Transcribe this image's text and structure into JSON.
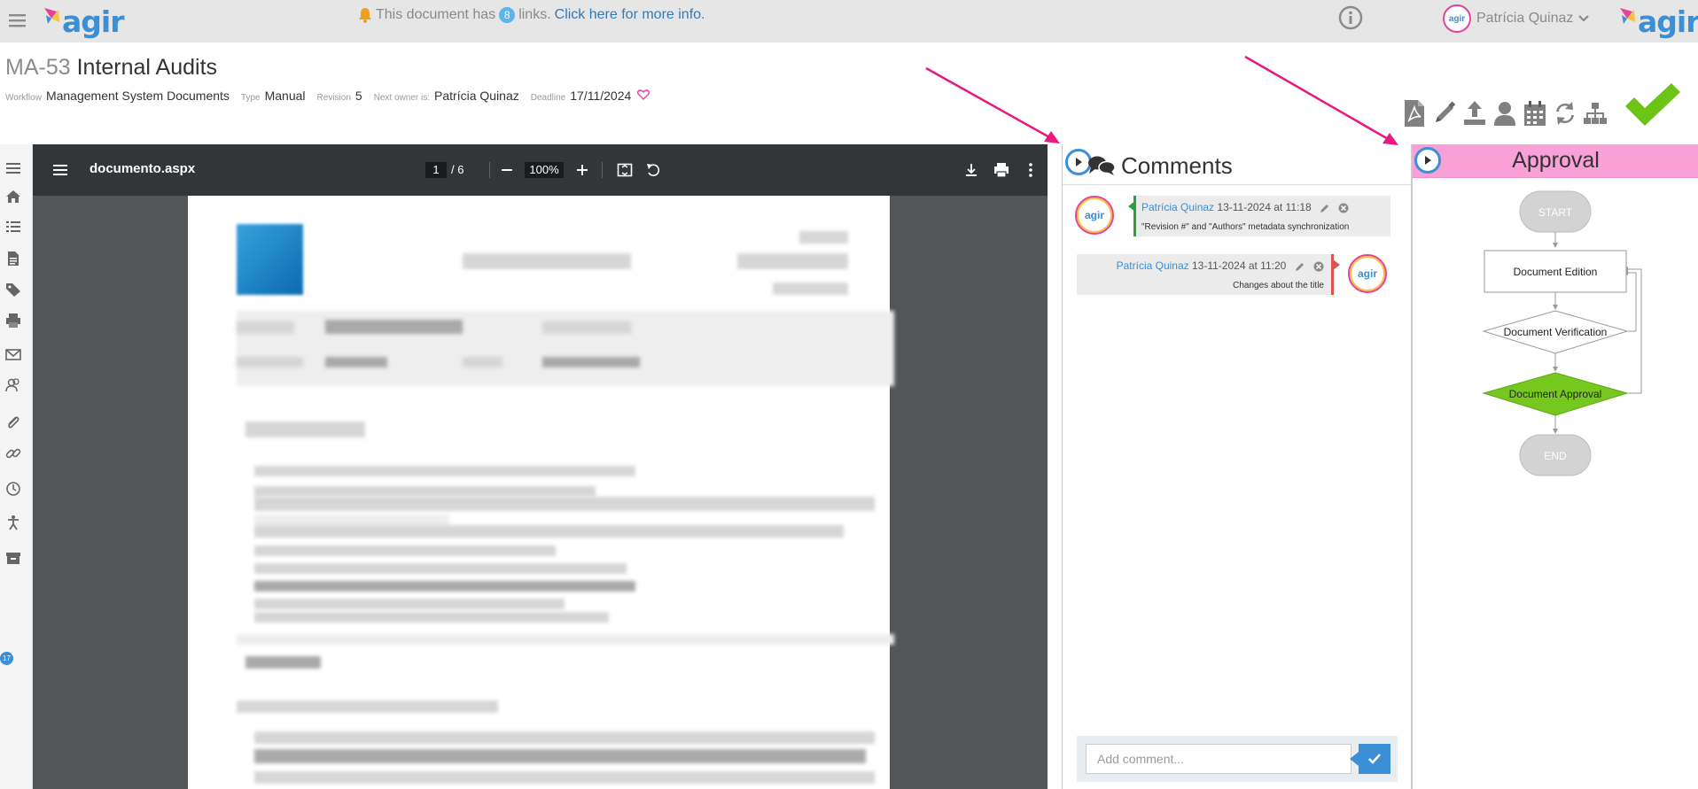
{
  "topbar": {
    "logo_text": "agir",
    "notice_prefix": "This document has",
    "notice_count": "8",
    "notice_suffix": "links.",
    "notice_link": "Click here for more info.",
    "user_name": "Patrícia Quinaz",
    "avatar_text": "agir"
  },
  "header": {
    "code": "MA-53",
    "title": "Internal Audits",
    "meta": {
      "workflow_label": "Workflow",
      "workflow_value": "Management System Documents",
      "type_label": "Type",
      "type_value": "Manual",
      "revision_label": "Revision",
      "revision_value": "5",
      "next_owner_label": "Next owner is:",
      "next_owner_value": "Patrícia Quinaz",
      "deadline_label": "Deadline",
      "deadline_value": "17/11/2024"
    },
    "actions": [
      "pdf-icon",
      "edit-icon",
      "upload-icon",
      "user-icon",
      "calendar-icon",
      "refresh-icon",
      "sitemap-icon",
      "check-icon"
    ]
  },
  "leftnav": {
    "icons": [
      "menu-icon",
      "home-icon",
      "list-icon",
      "document-icon",
      "tag-icon",
      "print-icon",
      "mail-icon",
      "users-icon",
      "paperclip-icon",
      "link-icon",
      "clock-icon",
      "accessibility-icon",
      "archive-icon"
    ],
    "badge": "17"
  },
  "pdf": {
    "filename": "documento.aspx",
    "page": "1",
    "page_total": "/ 6",
    "zoom": "100%"
  },
  "comments": {
    "title": "Comments",
    "items": [
      {
        "author": "Patrícia Quinaz",
        "date": "13-11-2024 at 11:18",
        "text": "\"Revision #\" and \"Authors\" metadata synchronization",
        "accent": "#2e9e3e"
      },
      {
        "author": "Patrícia Quinaz",
        "date": "13-11-2024 at 11:20",
        "text": "Changes about the title",
        "accent": "#d9534f"
      }
    ],
    "avatar_text": "agir",
    "add_placeholder": "Add comment..."
  },
  "approval": {
    "title": "Approval",
    "flow": {
      "start": "START",
      "edition": "Document Edition",
      "verification": "Document Verification",
      "approval": "Document Approval",
      "end": "END"
    },
    "colors": {
      "header": "#f9a0d6",
      "current_step": "#76c81e",
      "terminal": "#d3d3d3"
    }
  },
  "colors": {
    "accent": "#3a8fd6",
    "brand_pink": "#e8419a",
    "annotation_arrow": "#e8197f",
    "check_green": "#6cc417"
  }
}
